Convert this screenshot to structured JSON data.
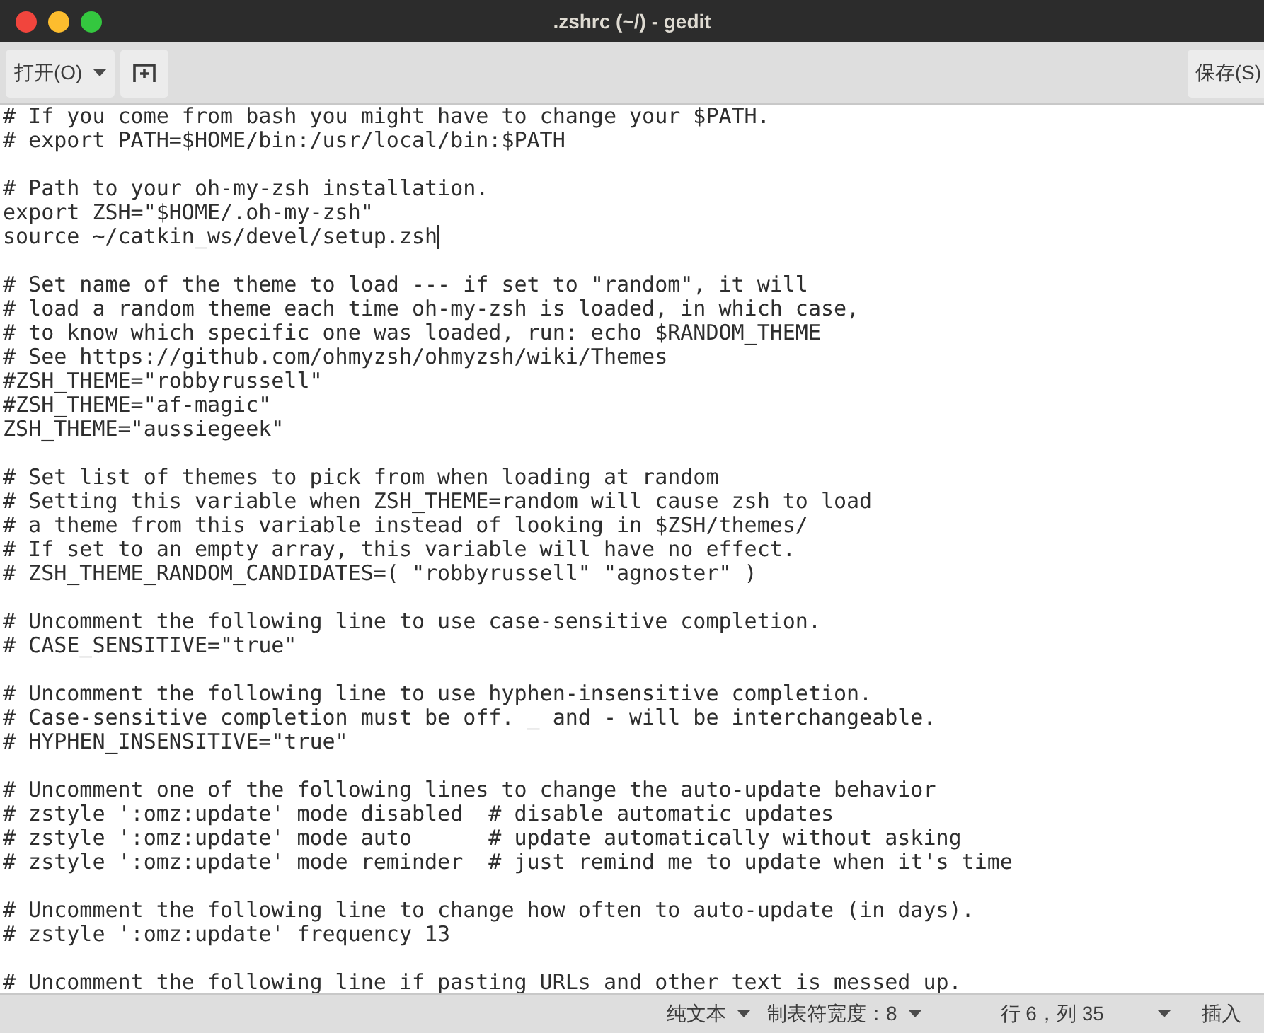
{
  "window": {
    "title": ".zshrc (~/) - gedit"
  },
  "toolbar": {
    "open_button": "打开(O)",
    "save_button": "保存(S)"
  },
  "editor": {
    "lines": [
      {
        "kind": "text",
        "text": "# If you come from bash you might have to change your $PATH."
      },
      {
        "kind": "text",
        "text": "# export PATH=$HOME/bin:/usr/local/bin:$PATH"
      },
      {
        "kind": "blank"
      },
      {
        "kind": "text",
        "text": "# Path to your oh-my-zsh installation."
      },
      {
        "kind": "text",
        "text": "export ZSH=\"$HOME/.oh-my-zsh\""
      },
      {
        "kind": "caret",
        "text": "source ~/catkin_ws/devel/setup.zsh"
      },
      {
        "kind": "blank"
      },
      {
        "kind": "text",
        "text": "# Set name of the theme to load --- if set to \"random\", it will"
      },
      {
        "kind": "text",
        "text": "# load a random theme each time oh-my-zsh is loaded, in which case,"
      },
      {
        "kind": "text",
        "text": "# to know which specific one was loaded, run: echo $RANDOM_THEME"
      },
      {
        "kind": "text",
        "text": "# See https://github.com/ohmyzsh/ohmyzsh/wiki/Themes"
      },
      {
        "kind": "text",
        "text": "#ZSH_THEME=\"robbyrussell\""
      },
      {
        "kind": "text",
        "text": "#ZSH_THEME=\"af-magic\""
      },
      {
        "kind": "text",
        "text": "ZSH_THEME=\"aussiegeek\""
      },
      {
        "kind": "blank"
      },
      {
        "kind": "text",
        "text": "# Set list of themes to pick from when loading at random"
      },
      {
        "kind": "text",
        "text": "# Setting this variable when ZSH_THEME=random will cause zsh to load"
      },
      {
        "kind": "text",
        "text": "# a theme from this variable instead of looking in $ZSH/themes/"
      },
      {
        "kind": "text",
        "text": "# If set to an empty array, this variable will have no effect."
      },
      {
        "kind": "text",
        "text": "# ZSH_THEME_RANDOM_CANDIDATES=( \"robbyrussell\" \"agnoster\" )"
      },
      {
        "kind": "blank"
      },
      {
        "kind": "text",
        "text": "# Uncomment the following line to use case-sensitive completion."
      },
      {
        "kind": "text",
        "text": "# CASE_SENSITIVE=\"true\""
      },
      {
        "kind": "blank"
      },
      {
        "kind": "text",
        "text": "# Uncomment the following line to use hyphen-insensitive completion."
      },
      {
        "kind": "text",
        "text": "# Case-sensitive completion must be off. _ and - will be interchangeable."
      },
      {
        "kind": "text",
        "text": "# HYPHEN_INSENSITIVE=\"true\""
      },
      {
        "kind": "blank"
      },
      {
        "kind": "text",
        "text": "# Uncomment one of the following lines to change the auto-update behavior"
      },
      {
        "kind": "text",
        "text": "# zstyle ':omz:update' mode disabled  # disable automatic updates"
      },
      {
        "kind": "text",
        "text": "# zstyle ':omz:update' mode auto      # update automatically without asking"
      },
      {
        "kind": "text",
        "text": "# zstyle ':omz:update' mode reminder  # just remind me to update when it's time"
      },
      {
        "kind": "blank"
      },
      {
        "kind": "text",
        "text": "# Uncomment the following line to change how often to auto-update (in days)."
      },
      {
        "kind": "text",
        "text": "# zstyle ':omz:update' frequency 13"
      },
      {
        "kind": "blank"
      },
      {
        "kind": "text",
        "text": "# Uncomment the following line if pasting URLs and other text is messed up."
      }
    ]
  },
  "status_bar": {
    "language": "纯文本",
    "tab_width": "制表符宽度：8",
    "position": "行 6，列 35",
    "mode": "插入"
  }
}
